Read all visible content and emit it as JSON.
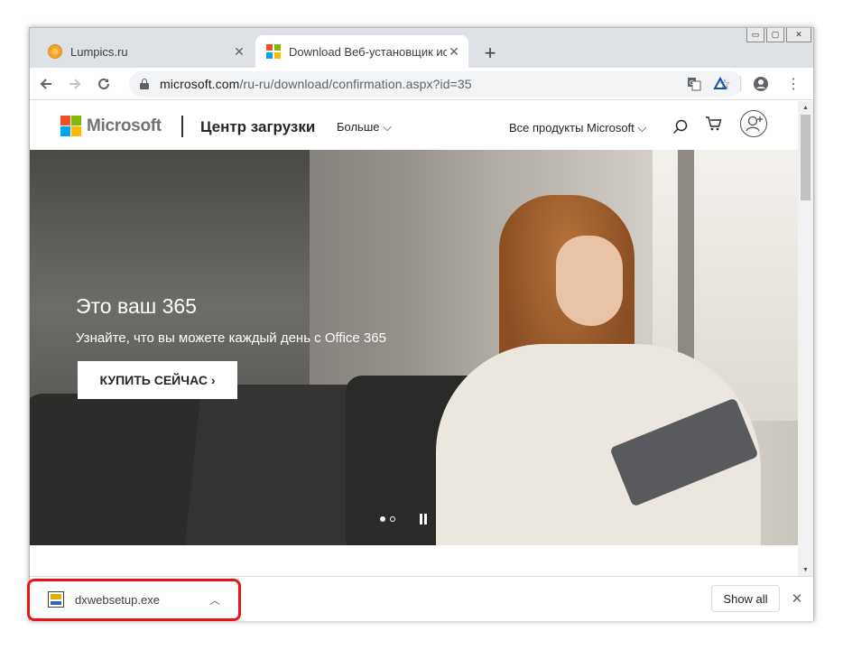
{
  "tabs": [
    {
      "title": "Lumpics.ru",
      "active": false,
      "favicon": "orange-circle-icon"
    },
    {
      "title": "Download Веб-установщик испо",
      "active": true,
      "favicon": "microsoft-icon"
    }
  ],
  "window_controls": {
    "minimize": "▭",
    "maximize": "▢",
    "close": "✕"
  },
  "toolbar": {
    "url_host": "microsoft.com",
    "url_path": "/ru-ru/download/confirmation.aspx?id=35"
  },
  "ms_header": {
    "logo_text": "Microsoft",
    "center_title": "Центр загрузки",
    "more": "Больше",
    "all_products": "Все продукты Microsoft"
  },
  "hero": {
    "heading": "Это ваш 365",
    "subheading": "Узнайте, что вы можете каждый день с Office 365",
    "button": "КУПИТЬ СЕЙЧАС"
  },
  "download_shelf": {
    "filename": "dxwebsetup.exe",
    "show_all": "Show all"
  },
  "colors": {
    "ms_red": "#f25022",
    "ms_green": "#7fba00",
    "ms_blue": "#00a4ef",
    "ms_yellow": "#ffb900",
    "highlight": "#e8141a",
    "tabstrip": "#dee1e6"
  }
}
